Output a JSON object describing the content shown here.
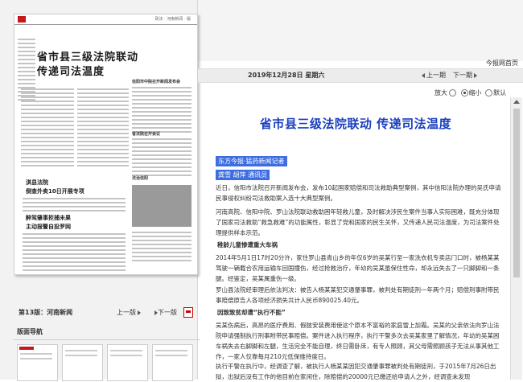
{
  "thumbnail": {
    "header_text": "政法 · 河南新闻 · 版",
    "headline_line1": "省市县三级法院联动",
    "headline_line2": "传递司法温度",
    "col_head_1": "信阳市中院召开新闻发布会",
    "col_head_2": "省法院召开会议",
    "col_head_3": "法治信阳",
    "subhead_1a": "淇县法院",
    "subhead_1b": "倒查外卖10日开展专项",
    "subhead_2a": "醉驾肇事拒捕未果",
    "subhead_2b": "主动报警自投罗网"
  },
  "edition": {
    "name": "第13版：河南新闻",
    "prev": "上一版",
    "next": "下一版"
  },
  "nav": {
    "title": "版面导航"
  },
  "header": {
    "today_link": "今报网首页"
  },
  "datebar": {
    "date": "2019年12月28日 星期六",
    "prev": "上一期",
    "next": "下一期"
  },
  "zoom": {
    "enlarge": "放大",
    "shrink": "缩小",
    "default": "默认"
  },
  "article": {
    "title": "省市县三级法院联动 传递司法温度",
    "byline1": "东方今报·猛药新闻记者",
    "byline2": "通讯员",
    "byline2_names": "龚雪 胡萍",
    "p1": "近日，信阳市法院召开新闻发布会，发布10起国家赔偿和司法救助典型案例，其中信阳法院办理的吴氏申请民事侵权纠纷司法救助案入选十大典型案例。",
    "p2": "河南高院、信阳中院、罗山法院联动救助困年轻救儿童，及时解决涉民生案件当事人实际困难，既充分体现了国家司法救助“救急救难”的功能属性，彰显了党和国家的民生关怀，又传递人民司法温度，为司法案件处理提供样本示范。",
    "subhead1": "稚龄儿童惨遭重大车祸",
    "p3": "2014年5月1日17时20分许，家住罗山县青山乡的年仅6岁的吴某行至一家洗衣机专卖店门口时，被杨某某驾驶一辆载合农用运输车回国撞伤，经过抢救治疗，年幼的吴某虽保住性命，却永远失去了一只脚脚和一条腿。经鉴定，吴某属重伤一级。",
    "p4": "罗山县法院经审理后依法判决：被告人杨某某犯交通肇事罪，被判处有期徒刑一年两个月；赔偿刑事附带民事赔偿原告人各项经济损失共计人民币890025.40元。",
    "subhead2": "因致致贫却遭“执行不能”",
    "p5": "吴某伤病后，高昂的医疗费用、假肢安装费用使这个原本不富裕的家庭雪上加霜。吴某的父亲依法向罗山法院申请强制执行刑事附带民事赔偿。案件进入执行程序，执行干警多次去吴某家里了解情况，年幼的吴某困车祸失去右脚脚和左腿，生活完全不能自理，终日需卧床，有专人照顾，其父母需照顾孩子无法从事其他工作，一家人仅靠每月210元低保维持度日。",
    "p6": "执行干警在执行中，经调查了解，被执行人杨某某因犯交通肇事罪被判处有期徒刑，于2015年7月26日出狱，出狱后没有工作的他目前在家闲住，除赔偿的20000元已缴还给申请人之外，经调查未发现"
  }
}
